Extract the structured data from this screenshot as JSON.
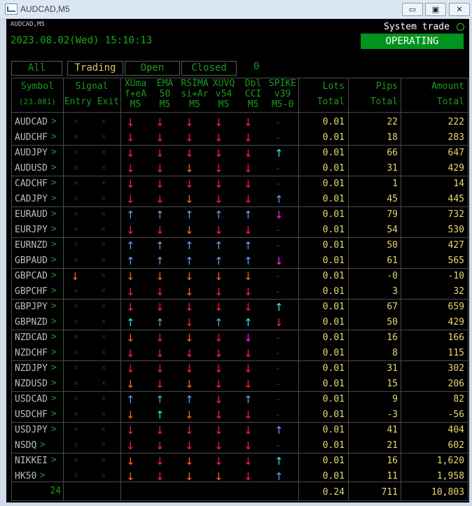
{
  "window": {
    "title": "AUDCAD,M5",
    "minimize": "▭",
    "restore": "▣",
    "close": "✕"
  },
  "header": {
    "symbol": "AUDCAD,M5",
    "datetime": "2023.08.02(Wed) 15:10:13",
    "system_label": "System trade",
    "status": "OPERATING"
  },
  "filters": {
    "all": "All",
    "trading": "Trading",
    "open": "Open",
    "closed": "Closed",
    "count": "0"
  },
  "columns": {
    "symbol": [
      "Symbol",
      "(23.081)"
    ],
    "signal": [
      "Signal",
      "Entry Exit"
    ],
    "c1": [
      "XUma",
      "f+eA",
      "M5"
    ],
    "c2": [
      "EMA",
      "50",
      "M5"
    ],
    "c3": [
      "RSIMA",
      "si+Ar",
      "M5"
    ],
    "c4": [
      "XUVQ",
      "v54",
      "M5"
    ],
    "c5": [
      "Dbl",
      "CCI",
      "M5"
    ],
    "c6": [
      "SPIKE",
      "v39",
      "M5-0"
    ],
    "lots": [
      "Lots",
      "Total"
    ],
    "pips": [
      "Pips",
      "Total"
    ],
    "amount": [
      "Amount",
      "Total"
    ]
  },
  "colors": {
    "red": "#ff2040",
    "orange": "#ff6a10",
    "blue": "#6aa0e8",
    "cyan": "#30f0f0",
    "magenta": "#ff20ff",
    "dash": "#666666"
  },
  "rows": [
    {
      "symbol": "AUDCAD",
      "chev": ">",
      "entry": "x",
      "exit": "x",
      "sig": [
        "red",
        "red",
        "red",
        "red",
        "red",
        "-"
      ],
      "lots": "0.01",
      "pips": "22",
      "amount": "222"
    },
    {
      "symbol": "AUDCHF",
      "chev": ">",
      "entry": "x",
      "exit": "x",
      "sig": [
        "red",
        "red",
        "red",
        "red",
        "red",
        "-"
      ],
      "lots": "0.01",
      "pips": "18",
      "amount": "283"
    },
    {
      "symbol": "AUDJPY",
      "chev": ">",
      "entry": "x",
      "exit": "x",
      "sig": [
        "red",
        "red",
        "red",
        "red",
        "red",
        "cyan-up"
      ],
      "lots": "0.01",
      "pips": "66",
      "amount": "647"
    },
    {
      "symbol": "AUDUSD",
      "chev": ">",
      "entry": "x",
      "exit": "x",
      "sig": [
        "red",
        "red",
        "orange",
        "red",
        "red",
        "-"
      ],
      "lots": "0.01",
      "pips": "31",
      "amount": "429"
    },
    {
      "symbol": "CADCHF",
      "chev": ">",
      "entry": "x",
      "exit": "x",
      "sig": [
        "red",
        "red",
        "red",
        "red",
        "red",
        "-"
      ],
      "lots": "0.01",
      "pips": "1",
      "amount": "14"
    },
    {
      "symbol": "CADJPY",
      "chev": ">",
      "entry": "x",
      "exit": "x",
      "sig": [
        "red",
        "red",
        "orange",
        "red",
        "red",
        "blue-up"
      ],
      "lots": "0.01",
      "pips": "45",
      "amount": "445"
    },
    {
      "symbol": "EURAUD",
      "chev": ">",
      "entry": "x",
      "exit": "x",
      "sig": [
        "blue-up",
        "blue-up",
        "blue-up",
        "blue-up",
        "blue-up",
        "magenta"
      ],
      "lots": "0.01",
      "pips": "79",
      "amount": "732"
    },
    {
      "symbol": "EURJPY",
      "chev": ">",
      "entry": "x",
      "exit": "x",
      "sig": [
        "red",
        "red",
        "orange",
        "red",
        "red",
        "-"
      ],
      "lots": "0.01",
      "pips": "54",
      "amount": "530"
    },
    {
      "symbol": "EURNZD",
      "chev": ">",
      "entry": "x",
      "exit": "x",
      "sig": [
        "blue-up",
        "blue-up",
        "blue-up",
        "blue-up",
        "blue-up",
        "-"
      ],
      "lots": "0.01",
      "pips": "50",
      "amount": "427"
    },
    {
      "symbol": "GBPAUD",
      "chev": ">",
      "entry": "x",
      "exit": "x",
      "sig": [
        "blue-up",
        "blue-up",
        "blue-up",
        "blue-up",
        "blue-up",
        "magenta"
      ],
      "lots": "0.01",
      "pips": "61",
      "amount": "565"
    },
    {
      "symbol": "GBPCAD",
      "chev": ">",
      "entry": "orange",
      "exit": "x",
      "sig": [
        "orange",
        "orange",
        "orange",
        "orange",
        "orange",
        "-"
      ],
      "lots": "0.01",
      "pips": "-0",
      "amount": "-10"
    },
    {
      "symbol": "GBPCHF",
      "chev": ">",
      "entry": "x",
      "exit": "x",
      "sig": [
        "red",
        "red",
        "orange",
        "red",
        "red",
        "-"
      ],
      "lots": "0.01",
      "pips": "3",
      "amount": "32"
    },
    {
      "symbol": "GBPJPY",
      "chev": ">",
      "entry": "x",
      "exit": "x",
      "sig": [
        "red",
        "red",
        "red",
        "red",
        "red",
        "cyan-up"
      ],
      "lots": "0.01",
      "pips": "67",
      "amount": "659"
    },
    {
      "symbol": "GBPNZD",
      "chev": ">",
      "entry": "x",
      "exit": "x",
      "sig": [
        "cyan-up",
        "blue-up",
        "red",
        "blue-up",
        "cyan-up",
        "red"
      ],
      "lots": "0.01",
      "pips": "50",
      "amount": "429"
    },
    {
      "symbol": "NZDCAD",
      "chev": ">",
      "entry": "x",
      "exit": "x",
      "sig": [
        "orange",
        "red",
        "orange",
        "red",
        "magenta",
        "-"
      ],
      "lots": "0.01",
      "pips": "16",
      "amount": "166"
    },
    {
      "symbol": "NZDCHF",
      "chev": ">",
      "entry": "x",
      "exit": "x",
      "sig": [
        "red",
        "red",
        "red",
        "red",
        "red",
        "-"
      ],
      "lots": "0.01",
      "pips": "8",
      "amount": "115"
    },
    {
      "symbol": "NZDJPY",
      "chev": ">",
      "entry": "x",
      "exit": "x",
      "sig": [
        "red",
        "red",
        "red",
        "red",
        "red",
        "-"
      ],
      "lots": "0.01",
      "pips": "31",
      "amount": "302"
    },
    {
      "symbol": "NZDUSD",
      "chev": ">",
      "entry": "x",
      "exit": "x",
      "sig": [
        "orange",
        "red",
        "orange",
        "red",
        "red",
        "-"
      ],
      "lots": "0.01",
      "pips": "15",
      "amount": "206"
    },
    {
      "symbol": "USDCAD",
      "chev": ">",
      "entry": "x",
      "exit": "x",
      "sig": [
        "blue-up",
        "blue-up",
        "blue-up",
        "red",
        "blue-up",
        "-"
      ],
      "lots": "0.01",
      "pips": "9",
      "amount": "82"
    },
    {
      "symbol": "USDCHF",
      "chev": ">",
      "entry": "x",
      "exit": "x",
      "sig": [
        "orange",
        "cyan-up",
        "orange",
        "red",
        "red",
        "-"
      ],
      "lots": "0.01",
      "pips": "-3",
      "amount": "-56"
    },
    {
      "symbol": "USDJPY",
      "chev": ">",
      "entry": "x",
      "exit": "x",
      "sig": [
        "red",
        "red",
        "red",
        "red",
        "red",
        "blue-up"
      ],
      "lots": "0.01",
      "pips": "41",
      "amount": "404"
    },
    {
      "symbol": "NSDQ",
      "chev": ">",
      "entry": "x",
      "exit": "x",
      "sig": [
        "red",
        "red",
        "red",
        "red",
        "red",
        "-"
      ],
      "lots": "0.01",
      "pips": "21",
      "amount": "602"
    },
    {
      "symbol": "NIKKEI",
      "chev": ">",
      "entry": "x",
      "exit": "x",
      "sig": [
        "orange",
        "red",
        "orange",
        "red",
        "red",
        "cyan-up"
      ],
      "lots": "0.01",
      "pips": "16",
      "amount": "1,620"
    },
    {
      "symbol": "HK50",
      "chev": ">",
      "entry": "x",
      "exit": "x",
      "sig": [
        "orange",
        "red",
        "orange",
        "orange",
        "red",
        "blue-up"
      ],
      "lots": "0.01",
      "pips": "11",
      "amount": "1,958"
    }
  ],
  "totals": {
    "count": "24",
    "lots": "0.24",
    "pips": "711",
    "amount": "10,803"
  }
}
